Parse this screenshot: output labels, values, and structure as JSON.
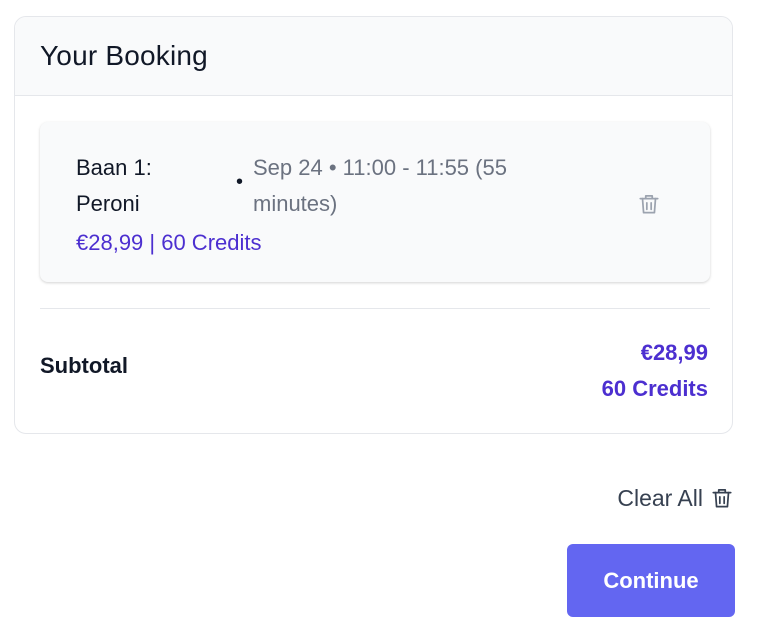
{
  "booking": {
    "title": "Your Booking",
    "item": {
      "court": "Baan 1: Peroni",
      "separator": "•",
      "time": "Sep 24 • 11:00 - 11:55 (55 minutes)",
      "price": "€28,99 | 60 Credits",
      "remove_icon": "trash-icon"
    },
    "subtotal": {
      "label": "Subtotal",
      "price": "€28,99",
      "credits": "60 Credits"
    }
  },
  "actions": {
    "clear_all_label": "Clear All",
    "clear_all_icon": "trash-icon",
    "continue_label": "Continue"
  },
  "colors": {
    "accent_text": "#4c2fd0",
    "button": "#6366f1",
    "muted_text": "#6b7280"
  }
}
